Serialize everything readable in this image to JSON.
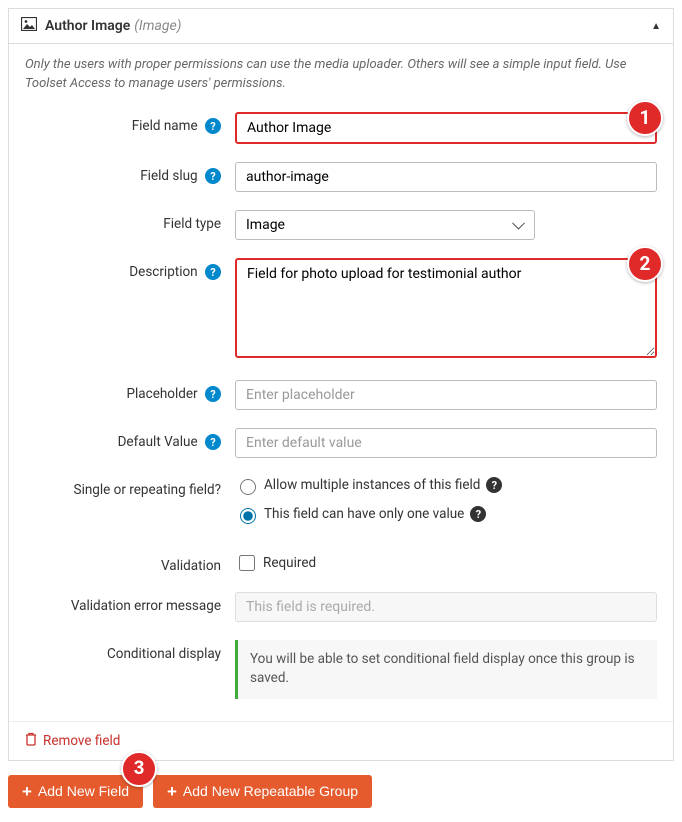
{
  "header": {
    "title": "Author Image",
    "type_suffix": "(Image)"
  },
  "intro": "Only the users with proper permissions can use the media uploader. Others will see a simple input field. Use Toolset Access to manage users' permissions.",
  "labels": {
    "field_name": "Field name",
    "field_slug": "Field slug",
    "field_type": "Field type",
    "description": "Description",
    "placeholder": "Placeholder",
    "default_value": "Default Value",
    "repeating": "Single or repeating field?",
    "validation": "Validation",
    "validation_msg": "Validation error message",
    "conditional": "Conditional display"
  },
  "values": {
    "field_name": "Author Image",
    "field_slug": "author-image",
    "field_type": "Image",
    "description": "Field for photo upload for testimonial author",
    "placeholder": "",
    "default_value": ""
  },
  "placeholders": {
    "placeholder": "Enter placeholder",
    "default_value": "Enter default value",
    "validation_msg": "This field is required."
  },
  "options": {
    "allow_multiple": "Allow multiple instances of this field",
    "only_one": "This field can have only one value",
    "required": "Required"
  },
  "conditional_note": "You will be able to set conditional field display once this group is saved.",
  "footer": {
    "remove": "Remove field"
  },
  "actions": {
    "add_field": "Add New Field",
    "add_group": "Add New Repeatable Group"
  },
  "callouts": {
    "c1": "1",
    "c2": "2",
    "c3": "3"
  }
}
